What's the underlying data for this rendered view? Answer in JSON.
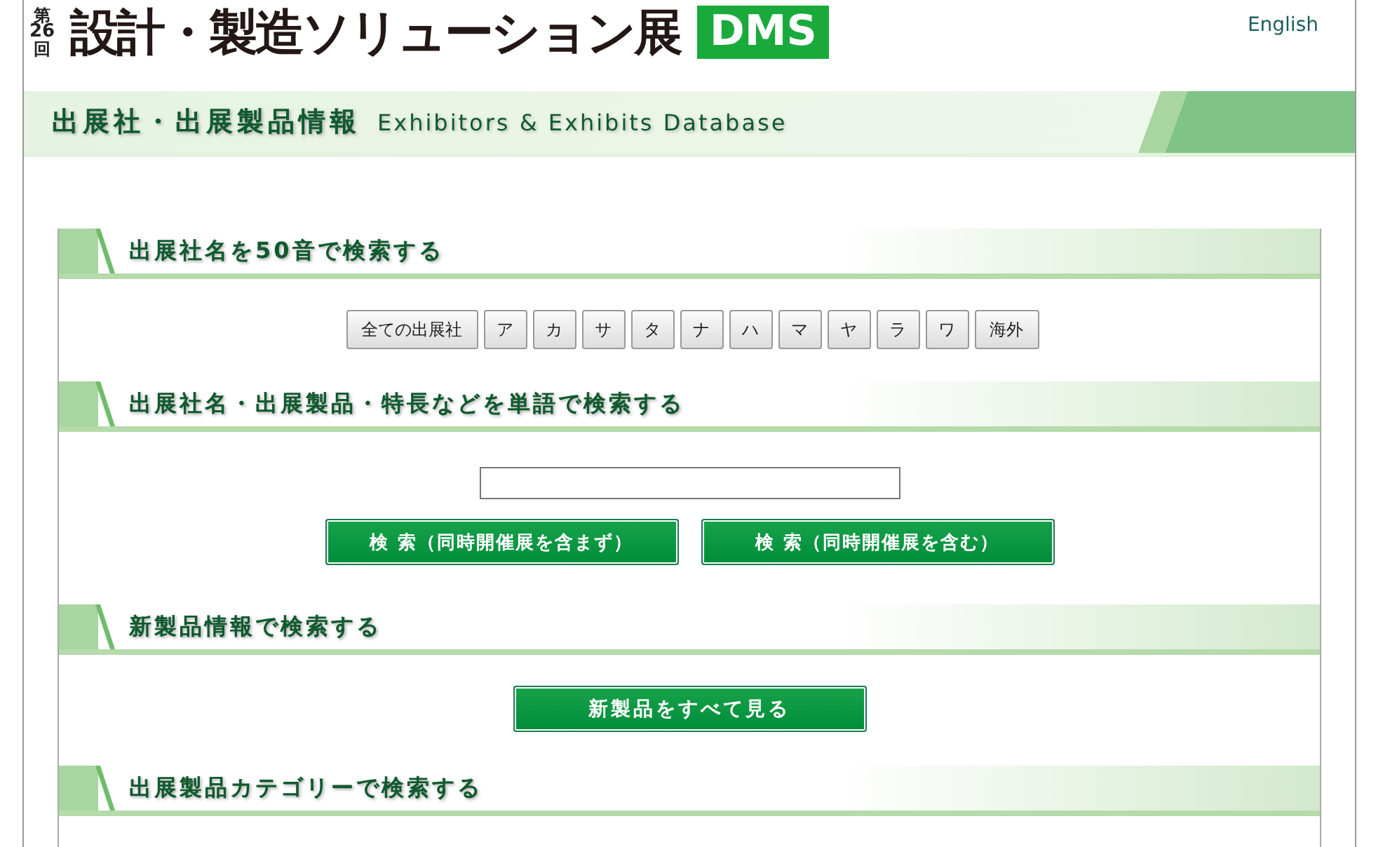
{
  "header": {
    "edition": [
      "第",
      "26",
      "回"
    ],
    "title": "設計・製造ソリューション展",
    "badge": "DMS",
    "language_link": "English"
  },
  "banner": {
    "title": "出展社・出展製品情報",
    "subtitle": "Exhibitors & Exhibits Database"
  },
  "sections": [
    {
      "kind": "letters",
      "heading": "出展社名を50音で検索する",
      "buttons": [
        "全ての出展社",
        "ア",
        "カ",
        "サ",
        "タ",
        "ナ",
        "ハ",
        "マ",
        "ヤ",
        "ラ",
        "ワ",
        "海外"
      ]
    },
    {
      "kind": "search",
      "heading": "出展社名・出展製品・特長などを単語で検索する",
      "buttons": [
        "検 索（同時開催展を含まず）",
        "検 索（同時開催展を含む）"
      ]
    },
    {
      "kind": "action",
      "heading": "新製品情報で検索する",
      "buttons": [
        "新製品をすべて見る"
      ]
    },
    {
      "kind": "heading",
      "heading": "出展製品カテゴリーで検索する"
    }
  ]
}
